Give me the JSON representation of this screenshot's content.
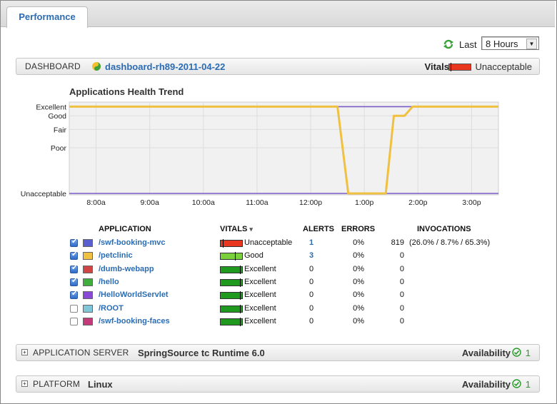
{
  "tabs": {
    "performance": "Performance"
  },
  "timerange": {
    "last_label": "Last",
    "selected": "8 Hours"
  },
  "dashboard": {
    "section_label": "DASHBOARD",
    "name": "dashboard-rh89-2011-04-22",
    "vitals_label": "Vitals",
    "vitals_status": "Unacceptable",
    "vitals_color": "#e8361f"
  },
  "chart_data": {
    "type": "line",
    "title": "Applications Health Trend",
    "y_categories": [
      "Unacceptable",
      "Poor",
      "Fair",
      "Good",
      "Excellent"
    ],
    "y_values_map": {
      "Unacceptable": 0,
      "Poor": 50,
      "Fair": 70,
      "Good": 85,
      "Excellent": 95
    },
    "x_tick_labels": [
      "8:00a",
      "9:00a",
      "10:00a",
      "11:00a",
      "12:00p",
      "1:00p",
      "2:00p",
      "3:00p"
    ],
    "x_unit": "hours since 7:30a",
    "grid": true,
    "series": [
      {
        "color": "#f0c040",
        "points": [
          [
            0,
            95
          ],
          [
            5,
            95
          ],
          [
            5.2,
            0
          ],
          [
            5.9,
            0
          ],
          [
            6.05,
            85
          ],
          [
            6.25,
            85
          ],
          [
            6.4,
            95
          ],
          [
            8,
            95
          ]
        ]
      },
      {
        "color": "#7a5cc8",
        "points": [
          [
            0,
            95
          ],
          [
            4.3,
            95
          ],
          [
            4.35,
            95
          ],
          [
            8,
            95
          ]
        ]
      },
      {
        "color": "#7a5cc8",
        "points": [
          [
            0,
            0
          ],
          [
            8,
            0
          ]
        ]
      }
    ]
  },
  "table": {
    "headers": {
      "application": "APPLICATION",
      "vitals": "VITALS",
      "alerts": "ALERTS",
      "errors": "ERRORS",
      "invocations": "INVOCATIONS"
    },
    "sort_indicator": "▾",
    "rows": [
      {
        "checked": true,
        "color": "#5a5fd0",
        "name": "/swf-booking-mvc",
        "vitals": "Unacceptable",
        "vitals_color": "#e8361f",
        "alerts": "1",
        "errors": "0%",
        "invocations": "819",
        "inv_detail": "(26.0% / 8.7% / 65.3%)"
      },
      {
        "checked": true,
        "color": "#f0c040",
        "name": "/petclinic",
        "vitals": "Good",
        "vitals_color": "#7ad03a",
        "alerts": "3",
        "errors": "0%",
        "invocations": "0",
        "inv_detail": ""
      },
      {
        "checked": true,
        "color": "#d04444",
        "name": "/dumb-webapp",
        "vitals": "Excellent",
        "vitals_color": "#1f9a1f",
        "alerts": "0",
        "errors": "0%",
        "invocations": "0",
        "inv_detail": ""
      },
      {
        "checked": true,
        "color": "#3fae3f",
        "name": "/hello",
        "vitals": "Excellent",
        "vitals_color": "#1f9a1f",
        "alerts": "0",
        "errors": "0%",
        "invocations": "0",
        "inv_detail": ""
      },
      {
        "checked": true,
        "color": "#8a4ad8",
        "name": "/HelloWorldServlet",
        "vitals": "Excellent",
        "vitals_color": "#1f9a1f",
        "alerts": "0",
        "errors": "0%",
        "invocations": "0",
        "inv_detail": ""
      },
      {
        "checked": false,
        "color": "#7fc7d8",
        "name": "/ROOT",
        "vitals": "Excellent",
        "vitals_color": "#1f9a1f",
        "alerts": "0",
        "errors": "0%",
        "invocations": "0",
        "inv_detail": ""
      },
      {
        "checked": false,
        "color": "#c43a7a",
        "name": "/swf-booking-faces",
        "vitals": "Excellent",
        "vitals_color": "#1f9a1f",
        "alerts": "0",
        "errors": "0%",
        "invocations": "0",
        "inv_detail": ""
      }
    ]
  },
  "app_server": {
    "expander": "+",
    "section_label": "APPLICATION SERVER",
    "value": "SpringSource tc Runtime 6.0",
    "availability_label": "Availability",
    "availability_count": "1"
  },
  "platform": {
    "expander": "+",
    "section_label": "PLATFORM",
    "value": "Linux",
    "availability_label": "Availability",
    "availability_count": "1"
  }
}
